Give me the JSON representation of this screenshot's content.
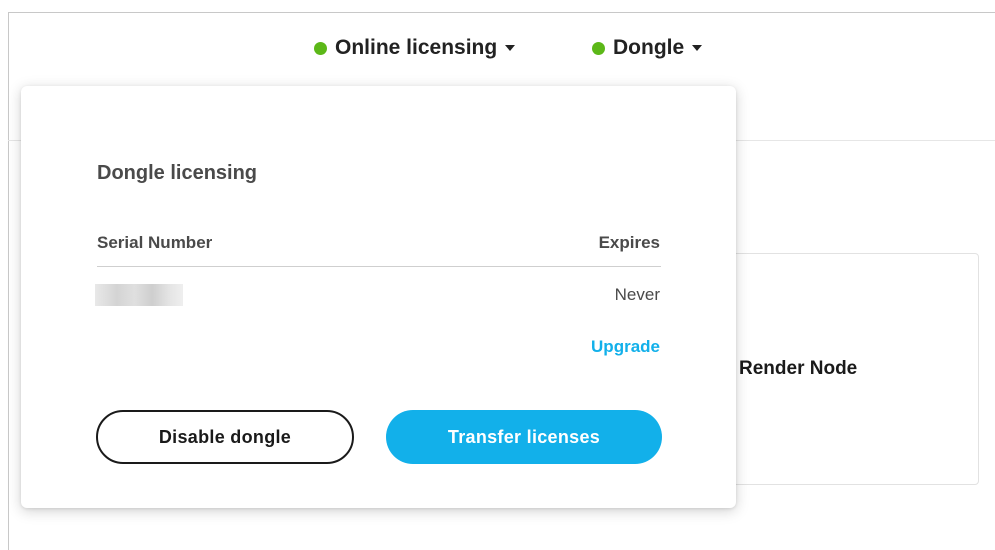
{
  "status_bar": {
    "online": {
      "label": "Online licensing",
      "status_color": "#5cb818"
    },
    "dongle": {
      "label": "Dongle",
      "status_color": "#5cb818"
    }
  },
  "background_card": {
    "title": "Render Node"
  },
  "popup": {
    "title": "Dongle licensing",
    "table": {
      "headers": {
        "serial": "Serial Number",
        "expires": "Expires"
      },
      "rows": [
        {
          "serial": "",
          "expires": "Never"
        }
      ]
    },
    "upgrade_label": "Upgrade",
    "buttons": {
      "disable": "Disable dongle",
      "transfer": "Transfer licenses"
    }
  },
  "colors": {
    "accent": "#12b0ea",
    "status_ok": "#5cb818",
    "text": "#4a4a4a"
  }
}
